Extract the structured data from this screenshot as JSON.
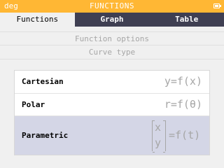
{
  "status": {
    "angle_unit": "deg",
    "title": "FUNCTIONS",
    "battery": "battery-icon"
  },
  "tabs": [
    {
      "label": "Functions",
      "active": true
    },
    {
      "label": "Graph",
      "active": false
    },
    {
      "label": "Table",
      "active": false
    }
  ],
  "sections": {
    "function_options": "Function options",
    "curve_type": "Curve type"
  },
  "curve_types": [
    {
      "label": "Cartesian",
      "formula": "y=f(x)",
      "selected": false
    },
    {
      "label": "Polar",
      "formula": "r=f(θ)",
      "selected": false
    },
    {
      "label": "Parametric",
      "formula_top": "x",
      "formula_bottom": "y",
      "formula_rhs": "=f(t)",
      "selected": true
    }
  ],
  "colors": {
    "status_bar": "#ffb734",
    "tab_bar": "#3f3f52",
    "selected_row": "#d4d6e6",
    "muted_text": "#a6a6a6"
  }
}
